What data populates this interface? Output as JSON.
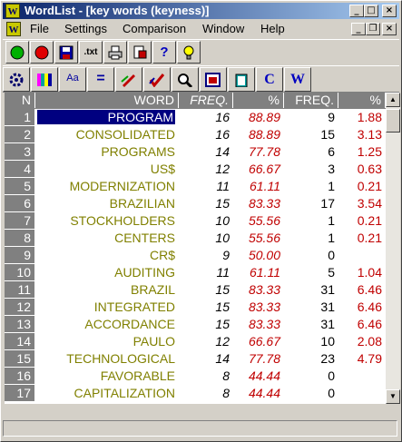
{
  "window": {
    "title": "WordList - [key words (keyness)]",
    "app_icon": "W"
  },
  "title_buttons": [
    "minimize-icon",
    "maximize-icon",
    "close-icon"
  ],
  "menu": {
    "items": [
      "File",
      "Settings",
      "Comparison",
      "Window",
      "Help"
    ],
    "underline": [
      "F",
      "S",
      "C",
      "W",
      "H"
    ]
  },
  "toolbar1": [
    {
      "name": "go-button",
      "icon": "green-circle-icon"
    },
    {
      "name": "stop-button",
      "icon": "red-circle-icon"
    },
    {
      "name": "save-button",
      "icon": "save-disk-icon"
    },
    {
      "name": "text-export-button",
      "label": ".txt"
    },
    {
      "name": "print-button",
      "icon": "printer-icon"
    },
    {
      "name": "print-preview-button",
      "icon": "print-preview-icon"
    },
    {
      "name": "help-button",
      "label": "?"
    },
    {
      "name": "tip-button",
      "icon": "lightbulb-icon"
    }
  ],
  "toolbar2": [
    {
      "name": "settings-button",
      "icon": "gear-icon"
    },
    {
      "name": "columns-button",
      "icon": "columns-icon"
    },
    {
      "name": "font-button",
      "label": "Aa"
    },
    {
      "name": "equals-button",
      "label": "="
    },
    {
      "name": "edit-button",
      "icon": "pencil-icon"
    },
    {
      "name": "check-button",
      "icon": "check-icon"
    },
    {
      "name": "search-button",
      "icon": "magnifier-icon"
    },
    {
      "name": "window-button",
      "icon": "window-icon"
    },
    {
      "name": "clipboard-button",
      "icon": "clipboard-icon"
    },
    {
      "name": "concord-button",
      "label": "C"
    },
    {
      "name": "wordlist-button",
      "label": "W"
    }
  ],
  "table": {
    "headers": [
      "N",
      "WORD",
      "FREQ.",
      "%",
      "FREQ.",
      "%"
    ],
    "rows": [
      [
        "1",
        "PROGRAM",
        "16",
        "88.89",
        "9",
        "1.88"
      ],
      [
        "2",
        "CONSOLIDATED",
        "16",
        "88.89",
        "15",
        "3.13"
      ],
      [
        "3",
        "PROGRAMS",
        "14",
        "77.78",
        "6",
        "1.25"
      ],
      [
        "4",
        "US$",
        "12",
        "66.67",
        "3",
        "0.63"
      ],
      [
        "5",
        "MODERNIZATION",
        "11",
        "61.11",
        "1",
        "0.21"
      ],
      [
        "6",
        "BRAZILIAN",
        "15",
        "83.33",
        "17",
        "3.54"
      ],
      [
        "7",
        "STOCKHOLDERS",
        "10",
        "55.56",
        "1",
        "0.21"
      ],
      [
        "8",
        "CENTERS",
        "10",
        "55.56",
        "1",
        "0.21"
      ],
      [
        "9",
        "CR$",
        "9",
        "50.00",
        "0",
        ""
      ],
      [
        "10",
        "AUDITING",
        "11",
        "61.11",
        "5",
        "1.04"
      ],
      [
        "11",
        "BRAZIL",
        "15",
        "83.33",
        "31",
        "6.46"
      ],
      [
        "12",
        "INTEGRATED",
        "15",
        "83.33",
        "31",
        "6.46"
      ],
      [
        "13",
        "ACCORDANCE",
        "15",
        "83.33",
        "31",
        "6.46"
      ],
      [
        "14",
        "PAULO",
        "12",
        "66.67",
        "10",
        "2.08"
      ],
      [
        "15",
        "TECHNOLOGICAL",
        "14",
        "77.78",
        "23",
        "4.79"
      ],
      [
        "16",
        "FAVORABLE",
        "8",
        "44.44",
        "0",
        ""
      ],
      [
        "17",
        "CAPITALIZATION",
        "8",
        "44.44",
        "0",
        ""
      ]
    ],
    "selected_row": 0
  },
  "colors": {
    "titlebar": "#0a246a",
    "word": "#808000",
    "percent": "#c00000",
    "selection": "#000080"
  }
}
